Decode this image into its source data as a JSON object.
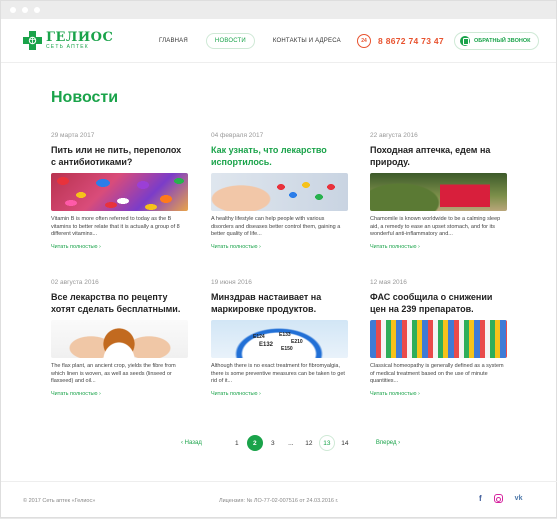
{
  "brand": {
    "name": "ГЕЛИОС",
    "subtitle": "СЕТЬ АПТЕК",
    "color": "#1aa34a"
  },
  "nav": [
    {
      "label": "ГЛАВНАЯ",
      "active": false
    },
    {
      "label": "НОВОСТИ",
      "active": true
    },
    {
      "label": "КОНТАКТЫ И АДРЕСА",
      "active": false
    }
  ],
  "phone": {
    "badge": "24",
    "number": "8 8672 74 73 47",
    "color": "#e8522e"
  },
  "callback": {
    "label": "ОБРАТНЫЙ ЗВОНОК"
  },
  "page": {
    "title": "Новости"
  },
  "news": [
    {
      "date": "29 марта 2017",
      "title": "Пить или не пить, переполох с антибиотиками?",
      "text": "Vitamin B is more often referred to today as the B vitamins to better relate that it is actually a group of 8 different vitamins...",
      "link": "Читать полностью",
      "image": "pills-photo"
    },
    {
      "date": "04 февраля 2017",
      "title": "Как узнать, что лекарство испортилось.",
      "text": "A healthy lifestyle can help people with various disorders and diseases better control them, gaining a better quality of life...",
      "link": "Читать полностью",
      "image": "hand-pills-photo"
    },
    {
      "date": "22 августа 2016",
      "title": "Походная аптечка, едем на природу.",
      "text": "Chamomile is known worldwide to be a calming sleep aid, a remedy to ease an upset stomach, and for its wonderful anti-inflammatory and...",
      "link": "Читать полностью",
      "image": "first-aid-bag-photo"
    },
    {
      "date": "02 августа 2016",
      "title": "Все лекарства по рецепту хотят сделать бесплатными.",
      "text": "The flax plant, an ancient crop, yields the fibre from which linen is woven, as well as seeds (linseed or flaxseed) and oil...",
      "link": "Читать полностью",
      "image": "hands-pills-photo"
    },
    {
      "date": "19 июня 2016",
      "title": "Минздрав настаивает на маркировке продуктов.",
      "text": "Although there is no exact treatment for fibromyalgia, there is some preventive measures can be taken to get rid of it...",
      "link": "Читать полностью",
      "image": "e-additives-bowl-photo"
    },
    {
      "date": "12 мая 2016",
      "title": "ФАС сообщила о снижении цен на 239 препаратов.",
      "text": "Classical homeopathy is generally defined as a system of medical treatment based on the use of minute quantities...",
      "link": "Читать полностью",
      "image": "pharmacy-shelf-photo"
    }
  ],
  "bowl_labels": [
    "E132",
    "E124",
    "E133",
    "E150",
    "E210"
  ],
  "pagination": {
    "prev": "‹ Назад",
    "next": "Вперед ›",
    "pages": [
      "1",
      "2",
      "3",
      "...",
      "12",
      "13",
      "14"
    ],
    "current": "2",
    "marked": "13"
  },
  "footer": {
    "copyright": "© 2017 Сеть аптек «Гелиос»",
    "license": "Лицензия: № ЛО-77-02-007516 от 24.03.2016 г.",
    "social": [
      "facebook-icon",
      "instagram-icon",
      "vk-icon"
    ]
  }
}
